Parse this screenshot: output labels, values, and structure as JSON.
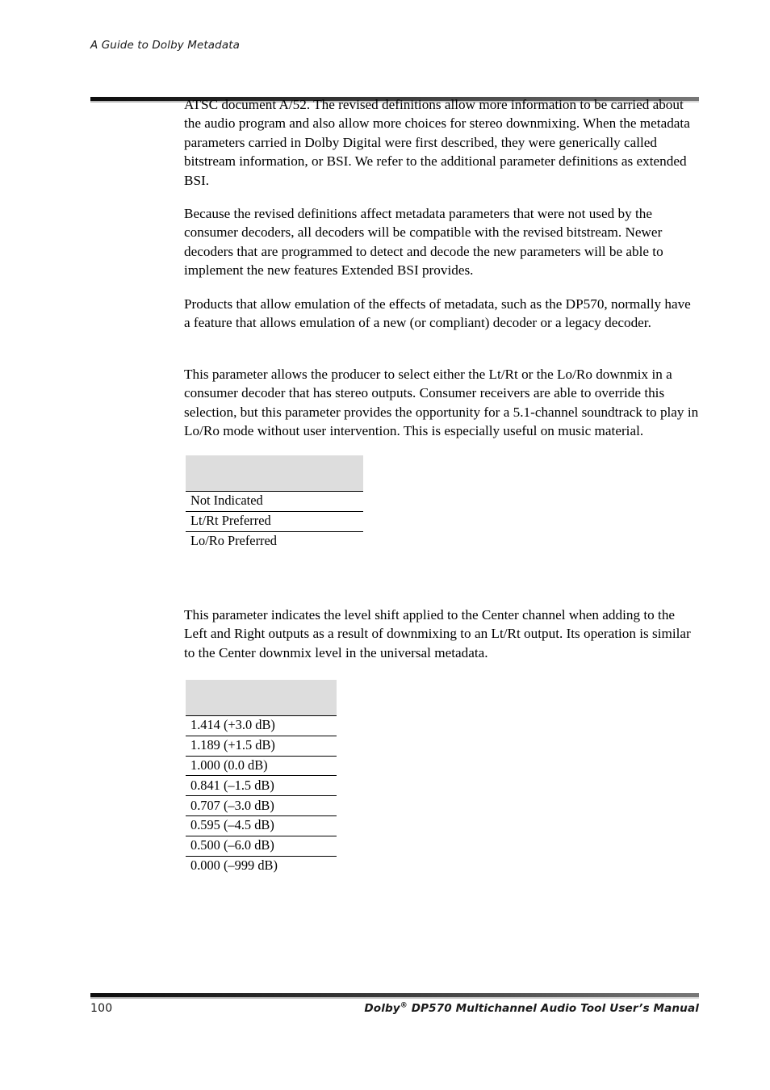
{
  "header": {
    "running_title": "A Guide to Dolby Metadata"
  },
  "body": {
    "paragraphs": [
      "ATSC document A/52. The revised definitions allow more information to be carried about the audio program and also allow more choices for stereo downmixing. When the metadata parameters carried in Dolby Digital were first described, they were generically called bitstream information, or BSI. We refer to the additional parameter definitions as extended BSI.",
      "Because the revised definitions affect metadata parameters that were not used by the consumer decoders, all decoders will be compatible with the revised bitstream. Newer decoders that are programmed to detect and decode the new parameters will be able to implement the new features Extended BSI provides.",
      "Products that allow emulation of the effects of metadata, such as the DP570, normally have a feature that allows emulation of a new (or compliant) decoder or a legacy decoder."
    ]
  },
  "section_preferred_downmix": {
    "heading": "",
    "description": "This parameter allows the producer to select either the Lt/Rt or the Lo/Ro downmix in a consumer decoder that has stereo outputs. Consumer receivers are able to override this selection, but this parameter provides the opportunity for a 5.1-channel soundtrack to play in Lo/Ro mode without user intervention. This is especially useful on music material.",
    "table": {
      "column_header": "",
      "rows": [
        "Not Indicated",
        "Lt/Rt Preferred",
        "Lo/Ro Preferred"
      ]
    }
  },
  "section_ltrt_center_mix_level": {
    "heading": "",
    "description": "This parameter indicates the level shift applied to the Center channel when adding to the Left and Right outputs as a result of downmixing to an Lt/Rt output. Its operation is similar to the Center downmix level in the universal metadata.",
    "table": {
      "column_header": "",
      "rows": [
        "1.414 (+3.0 dB)",
        "1.189 (+1.5 dB)",
        "1.000 (0.0 dB)",
        "0.841 (–1.5 dB)",
        "0.707 (–3.0 dB)",
        "0.595 (–4.5 dB)",
        "0.500 (–6.0 dB)",
        "0.000 (–999 dB)"
      ]
    }
  },
  "footer": {
    "page_number": "100",
    "manual_prefix": "Dolby",
    "manual_registered": "®",
    "manual_suffix": " DP570 Multichannel Audio Tool User’s Manual"
  },
  "colors": {
    "table_header_fill": "#dddddd",
    "rule_dark": "#0d0d0d",
    "rule_light": "#777777",
    "text": "#000000"
  }
}
